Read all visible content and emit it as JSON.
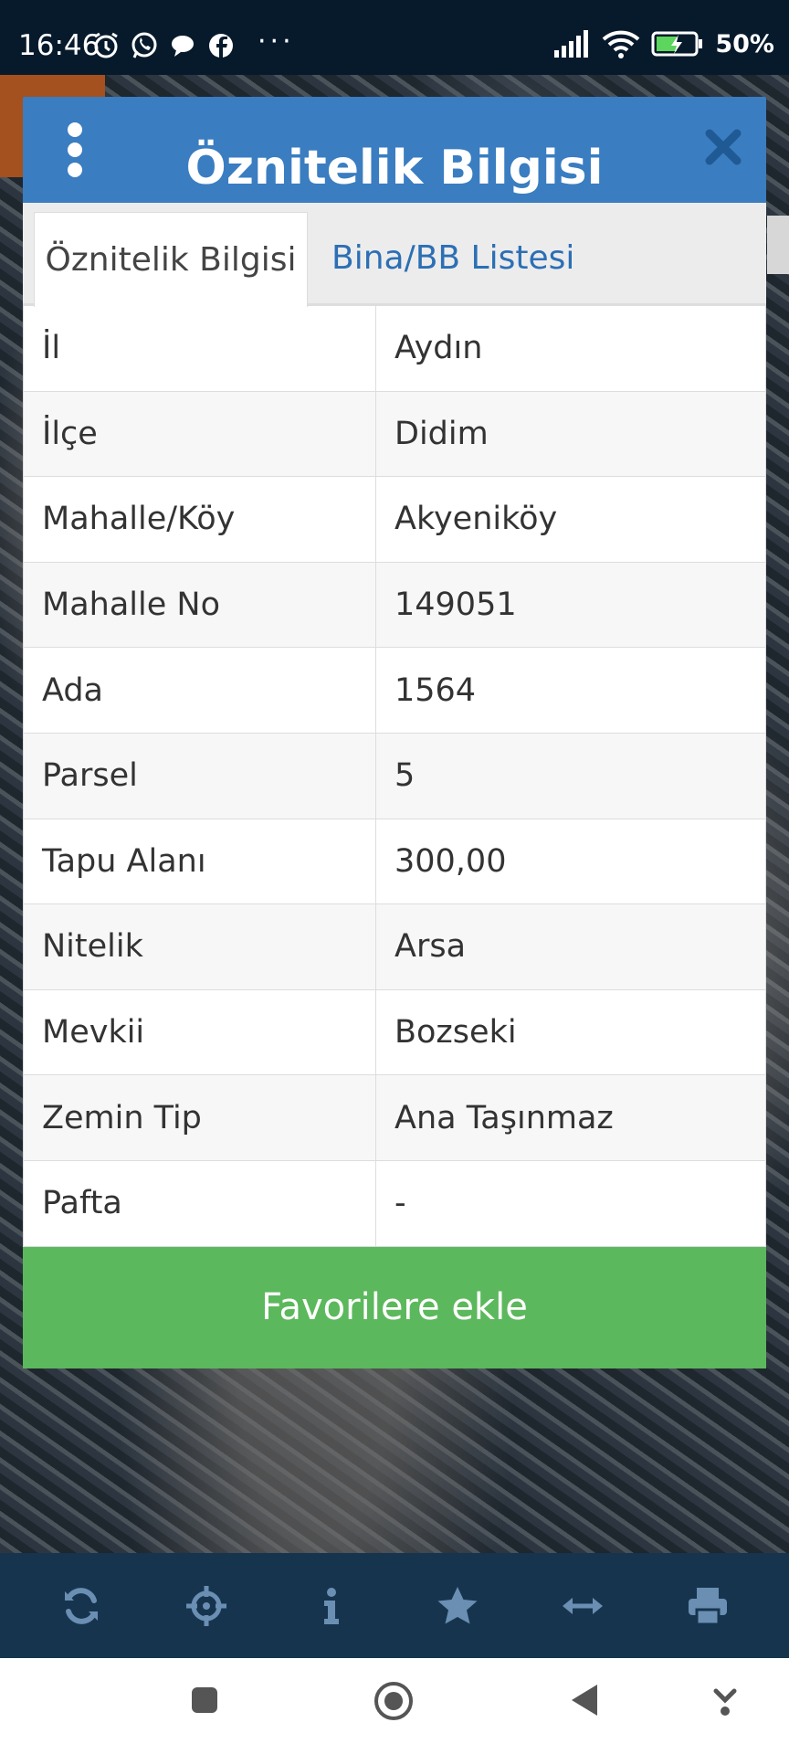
{
  "status_bar": {
    "time": "16:46",
    "dots": "···",
    "battery": "50%",
    "left_icons": [
      "alarm-icon",
      "whatsapp-icon",
      "chat-icon",
      "facebook-icon"
    ],
    "right_icons": [
      "signal-icon",
      "wifi-icon",
      "battery-charging-icon"
    ]
  },
  "dialog": {
    "title": "Öznitelik Bilgisi",
    "tabs": [
      {
        "label": "Öznitelik Bilgisi",
        "active": true
      },
      {
        "label": "Bina/BB Listesi",
        "active": false
      }
    ],
    "rows": [
      {
        "key": "İl",
        "value": "Aydın"
      },
      {
        "key": "İlçe",
        "value": "Didim"
      },
      {
        "key": "Mahalle/Köy",
        "value": "Akyeniköy"
      },
      {
        "key": "Mahalle No",
        "value": "149051"
      },
      {
        "key": "Ada",
        "value": "1564"
      },
      {
        "key": "Parsel",
        "value": "5"
      },
      {
        "key": "Tapu Alanı",
        "value": "300,00"
      },
      {
        "key": "Nitelik",
        "value": "Arsa"
      },
      {
        "key": "Mevkii",
        "value": "Bozseki"
      },
      {
        "key": "Zemin Tip",
        "value": "Ana Taşınmaz"
      },
      {
        "key": "Pafta",
        "value": "-"
      }
    ],
    "favorite_button": "Favorilere ekle"
  },
  "toolbar": {
    "icons": [
      "refresh-icon",
      "crosshair-icon",
      "info-icon",
      "star-icon",
      "measure-icon",
      "print-icon"
    ]
  },
  "colors": {
    "header_blue": "#3a7dc1",
    "tab_link": "#2c6fb5",
    "favorite_green": "#5cb85c",
    "toolbar": "#17344f",
    "status_bar": "#071a2c"
  }
}
